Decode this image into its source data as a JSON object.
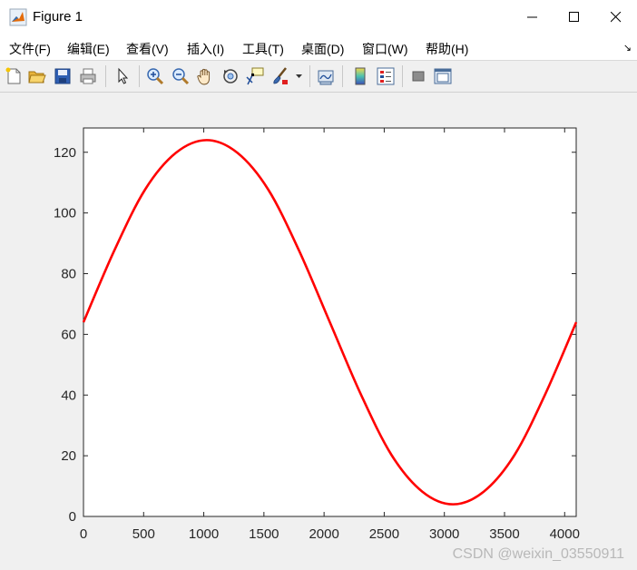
{
  "window": {
    "title": "Figure 1",
    "controls": {
      "minimize": "minimize",
      "maximize": "maximize",
      "close": "close"
    }
  },
  "menu": {
    "items": [
      {
        "label": "文件(F)"
      },
      {
        "label": "编辑(E)"
      },
      {
        "label": "查看(V)"
      },
      {
        "label": "插入(I)"
      },
      {
        "label": "工具(T)"
      },
      {
        "label": "桌面(D)"
      },
      {
        "label": "窗口(W)"
      },
      {
        "label": "帮助(H)"
      }
    ],
    "dock_arrow": "↘"
  },
  "toolbar": {
    "icons": [
      "new-figure-icon",
      "open-file-icon",
      "save-icon",
      "print-icon",
      "edit-plot-cursor-icon",
      "zoom-in-icon",
      "zoom-out-icon",
      "pan-hand-icon",
      "rotate-3d-icon",
      "data-cursor-icon",
      "brush-icon",
      "link-plot-icon",
      "insert-colorbar-icon",
      "insert-legend-icon",
      "hide-plot-tools-icon",
      "show-plot-tools-icon"
    ]
  },
  "chart_data": {
    "type": "line",
    "title": "",
    "xlabel": "",
    "ylabel": "",
    "xlim": [
      0,
      4096
    ],
    "ylim": [
      0,
      128
    ],
    "x_ticks": [
      0,
      500,
      1000,
      1500,
      2000,
      2500,
      3000,
      3500,
      4000
    ],
    "y_ticks": [
      0,
      20,
      40,
      60,
      80,
      100,
      120
    ],
    "grid": false,
    "legend": "none",
    "series": [
      {
        "color": "#ff0000",
        "x": [
          0,
          256,
          512,
          768,
          1024,
          1280,
          1536,
          1792,
          2048,
          2304,
          2560,
          2816,
          3072,
          3328,
          3584,
          3840,
          4096
        ],
        "y": [
          64,
          87.6,
          107.7,
          119.8,
          124,
          119.8,
          107.7,
          87.6,
          64,
          40.4,
          20.3,
          8.2,
          4,
          8.2,
          20.3,
          40.4,
          64
        ]
      }
    ]
  },
  "watermark": "CSDN @weixin_03550911"
}
